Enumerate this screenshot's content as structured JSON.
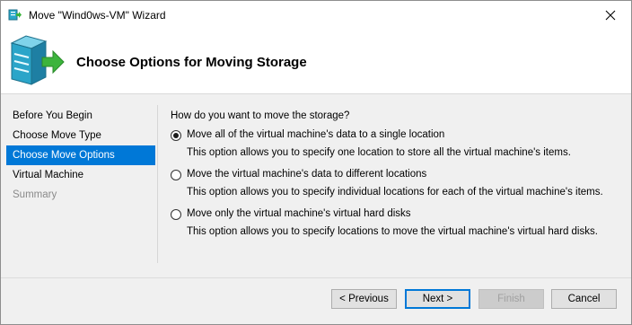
{
  "window": {
    "title": "Move \"Wind0ws-VM\" Wizard",
    "close_glyph": "✕"
  },
  "header": {
    "title": "Choose Options for Moving Storage",
    "icon": "storage-move-icon"
  },
  "nav": {
    "items": [
      {
        "label": "Before You Begin",
        "state": "normal"
      },
      {
        "label": "Choose Move Type",
        "state": "normal"
      },
      {
        "label": "Choose Move Options",
        "state": "active"
      },
      {
        "label": "Virtual Machine",
        "state": "normal"
      },
      {
        "label": "Summary",
        "state": "disabled"
      }
    ]
  },
  "main": {
    "question": "How do you want to move the storage?",
    "options": [
      {
        "label": "Move all of the virtual machine's data to a single location",
        "description": "This option allows you to specify one location to store all the virtual machine's items.",
        "checked": true
      },
      {
        "label": "Move the virtual machine's data to different locations",
        "description": "This option allows you to specify individual locations for each of the virtual machine's items.",
        "checked": false
      },
      {
        "label": "Move only the virtual machine's virtual hard disks",
        "description": "This option allows you to specify locations to move the virtual machine's virtual hard disks.",
        "checked": false
      }
    ]
  },
  "buttons": {
    "previous": "< Previous",
    "next": "Next >",
    "finish": "Finish",
    "cancel": "Cancel"
  },
  "colors": {
    "accent": "#0078d7",
    "icon_teal": "#2aa7c9",
    "arrow_green": "#3cb43c"
  }
}
